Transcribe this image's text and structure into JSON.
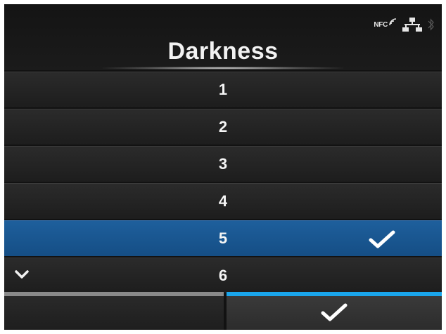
{
  "status_bar": {
    "nfc_label": "NFC",
    "icons": [
      "nfc-icon",
      "network-icon",
      "bluetooth-icon"
    ]
  },
  "screen": {
    "title": "Darkness"
  },
  "list": {
    "items": [
      {
        "label": "1",
        "selected": false
      },
      {
        "label": "2",
        "selected": false
      },
      {
        "label": "3",
        "selected": false
      },
      {
        "label": "4",
        "selected": false
      },
      {
        "label": "5",
        "selected": true
      },
      {
        "label": "6",
        "selected": false
      }
    ],
    "scroll_indicator": "chevron-down-icon"
  },
  "footer": {
    "back_button": "",
    "ok_button_icon": "checkmark-icon"
  },
  "colors": {
    "selected_row": "#1e5f9c",
    "ok_accent": "#1aa6ec",
    "back_accent": "#8a8a8a"
  }
}
